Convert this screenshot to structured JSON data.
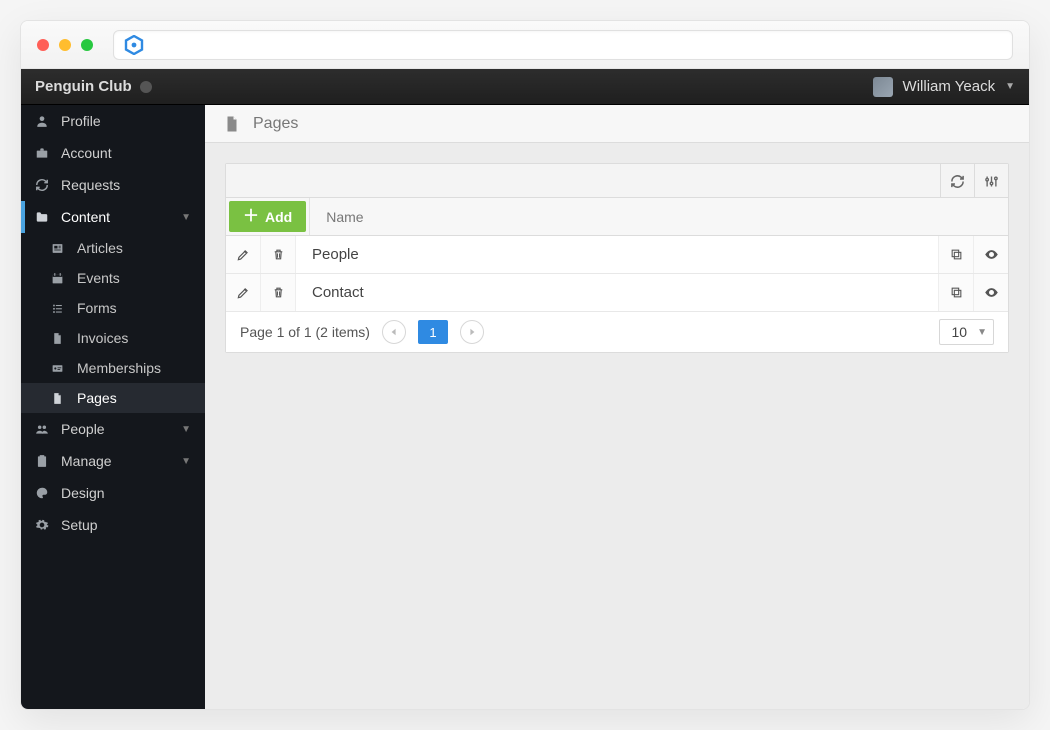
{
  "org": {
    "name": "Penguin Club"
  },
  "user": {
    "name": "William Yeack"
  },
  "sidebar": {
    "items": [
      {
        "label": "Profile"
      },
      {
        "label": "Account"
      },
      {
        "label": "Requests"
      },
      {
        "label": "Content"
      },
      {
        "label": "People"
      },
      {
        "label": "Manage"
      },
      {
        "label": "Design"
      },
      {
        "label": "Setup"
      }
    ],
    "content_children": [
      {
        "label": "Articles"
      },
      {
        "label": "Events"
      },
      {
        "label": "Forms"
      },
      {
        "label": "Invoices"
      },
      {
        "label": "Memberships"
      },
      {
        "label": "Pages"
      }
    ]
  },
  "page": {
    "title": "Pages"
  },
  "grid": {
    "add_label": "Add",
    "column_name": "Name",
    "rows": [
      {
        "name": "People"
      },
      {
        "name": "Contact"
      }
    ],
    "footer_text": "Page 1 of 1 (2 items)",
    "current_page": "1",
    "page_size": "10"
  }
}
